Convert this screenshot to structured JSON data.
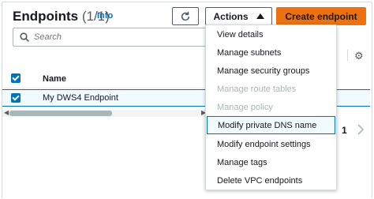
{
  "header": {
    "title": "Endpoints",
    "count": "(1/1)",
    "info": "Info",
    "actions_label": "Actions",
    "create_label": "Create endpoint"
  },
  "search": {
    "placeholder": "Search"
  },
  "table": {
    "columns": [
      "Name"
    ],
    "rows": [
      {
        "name": "My DWS4 Endpoint",
        "selected": true
      }
    ]
  },
  "pagination": {
    "current_page": "1"
  },
  "actions_menu": {
    "items": [
      {
        "label": "View details",
        "disabled": false
      },
      {
        "label": "Manage subnets",
        "disabled": false
      },
      {
        "label": "Manage security groups",
        "disabled": false
      },
      {
        "label": "Manage route tables",
        "disabled": true
      },
      {
        "label": "Manage policy",
        "disabled": true
      },
      {
        "label": "Modify private DNS name",
        "disabled": false,
        "highlighted": true
      },
      {
        "label": "Modify endpoint settings",
        "disabled": false
      },
      {
        "label": "Manage tags",
        "disabled": false
      },
      {
        "label": "Delete VPC endpoints",
        "disabled": false
      }
    ]
  },
  "icons": [
    "refresh-icon",
    "caret-up-icon",
    "search-icon",
    "settings-icon",
    "chevron-right-icon"
  ],
  "colors": {
    "primary": "#ec7211",
    "link": "#0073bb",
    "selected_row_bg": "#f1faff",
    "disabled_text": "#aab7b8"
  }
}
